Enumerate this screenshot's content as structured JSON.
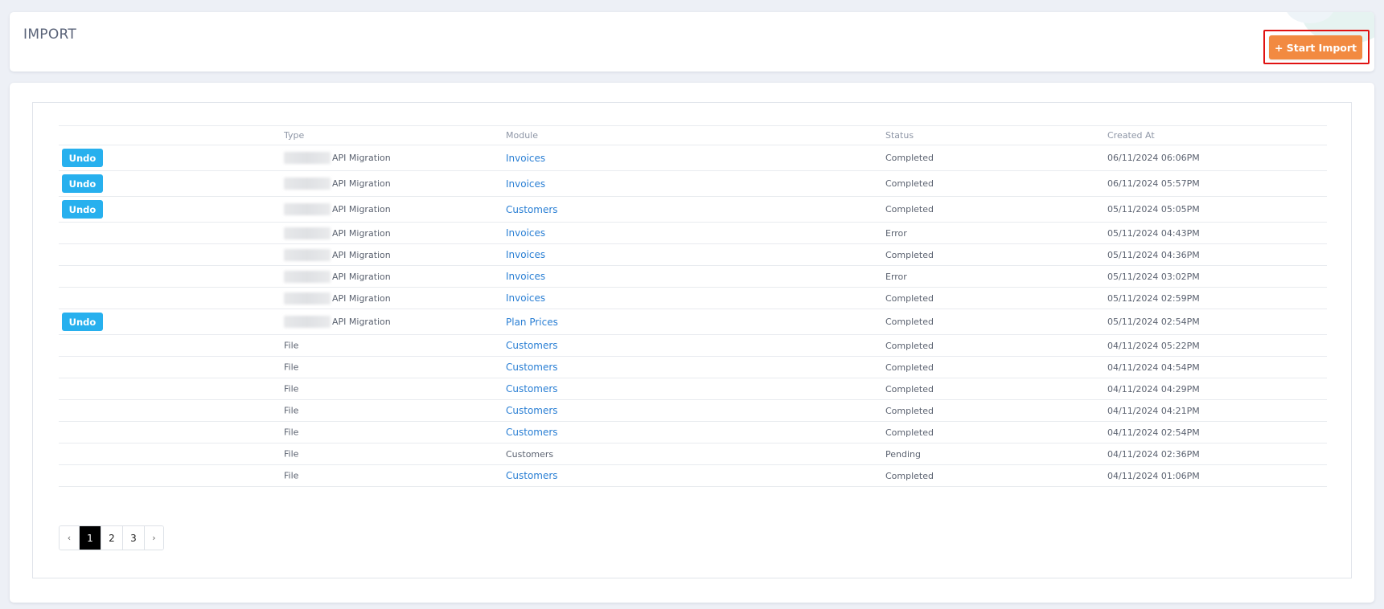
{
  "header": {
    "title": "IMPORT",
    "start_import_label": "+ Start Import"
  },
  "table": {
    "columns": [
      "",
      "Type",
      "Module",
      "Status",
      "Created At"
    ],
    "undo_label": "Undo",
    "rows": [
      {
        "undo": true,
        "type": "API Migration",
        "type_has_redacted_prefix": true,
        "module": "Invoices",
        "module_link": true,
        "status": "Completed",
        "created_at": "06/11/2024 06:06PM"
      },
      {
        "undo": true,
        "type": "API Migration",
        "type_has_redacted_prefix": true,
        "module": "Invoices",
        "module_link": true,
        "status": "Completed",
        "created_at": "06/11/2024 05:57PM"
      },
      {
        "undo": true,
        "type": "API Migration",
        "type_has_redacted_prefix": true,
        "module": "Customers",
        "module_link": true,
        "status": "Completed",
        "created_at": "05/11/2024 05:05PM"
      },
      {
        "undo": false,
        "type": "API Migration",
        "type_has_redacted_prefix": true,
        "module": "Invoices",
        "module_link": true,
        "status": "Error",
        "created_at": "05/11/2024 04:43PM"
      },
      {
        "undo": false,
        "type": "API Migration",
        "type_has_redacted_prefix": true,
        "module": "Invoices",
        "module_link": true,
        "status": "Completed",
        "created_at": "05/11/2024 04:36PM"
      },
      {
        "undo": false,
        "type": "API Migration",
        "type_has_redacted_prefix": true,
        "module": "Invoices",
        "module_link": true,
        "status": "Error",
        "created_at": "05/11/2024 03:02PM"
      },
      {
        "undo": false,
        "type": "API Migration",
        "type_has_redacted_prefix": true,
        "module": "Invoices",
        "module_link": true,
        "status": "Completed",
        "created_at": "05/11/2024 02:59PM"
      },
      {
        "undo": true,
        "type": "API Migration",
        "type_has_redacted_prefix": true,
        "module": "Plan Prices",
        "module_link": true,
        "status": "Completed",
        "created_at": "05/11/2024 02:54PM"
      },
      {
        "undo": false,
        "type": "File",
        "type_has_redacted_prefix": false,
        "module": "Customers",
        "module_link": true,
        "status": "Completed",
        "created_at": "04/11/2024 05:22PM"
      },
      {
        "undo": false,
        "type": "File",
        "type_has_redacted_prefix": false,
        "module": "Customers",
        "module_link": true,
        "status": "Completed",
        "created_at": "04/11/2024 04:54PM"
      },
      {
        "undo": false,
        "type": "File",
        "type_has_redacted_prefix": false,
        "module": "Customers",
        "module_link": true,
        "status": "Completed",
        "created_at": "04/11/2024 04:29PM"
      },
      {
        "undo": false,
        "type": "File",
        "type_has_redacted_prefix": false,
        "module": "Customers",
        "module_link": true,
        "status": "Completed",
        "created_at": "04/11/2024 04:21PM"
      },
      {
        "undo": false,
        "type": "File",
        "type_has_redacted_prefix": false,
        "module": "Customers",
        "module_link": true,
        "status": "Completed",
        "created_at": "04/11/2024 02:54PM"
      },
      {
        "undo": false,
        "type": "File",
        "type_has_redacted_prefix": false,
        "module": "Customers",
        "module_link": false,
        "status": "Pending",
        "created_at": "04/11/2024 02:36PM"
      },
      {
        "undo": false,
        "type": "File",
        "type_has_redacted_prefix": false,
        "module": "Customers",
        "module_link": true,
        "status": "Completed",
        "created_at": "04/11/2024 01:06PM"
      }
    ]
  },
  "pagination": {
    "prev": "‹",
    "next": "›",
    "pages": [
      "1",
      "2",
      "3"
    ],
    "current": "1"
  },
  "colors": {
    "accent_orange": "#f28a41",
    "undo_blue": "#27b0ee",
    "link_blue": "#2a7fd4",
    "highlight_red": "#e01212"
  }
}
